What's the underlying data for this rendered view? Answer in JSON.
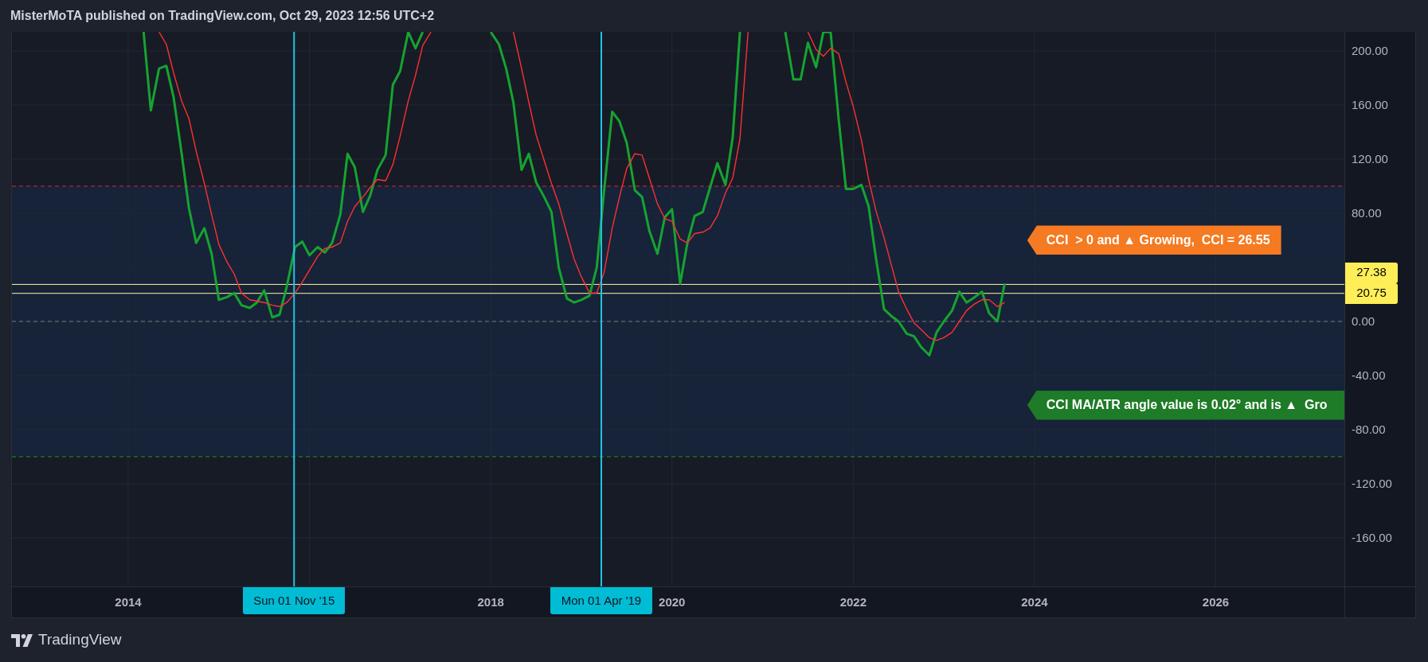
{
  "header": {
    "text": "MisterMoTA published on TradingView.com, Oct 29, 2023 12:56 UTC+2"
  },
  "chart": {
    "chart_data": {
      "type": "line",
      "xlim": [
        2012.717,
        2028.21
      ],
      "ylim": [
        -195.9,
        214.1
      ],
      "grid": true,
      "xticks": [
        2014,
        2018,
        2020,
        2022,
        2024,
        2026
      ],
      "yticks": [
        {
          "value": 200,
          "label": "200.00"
        },
        {
          "value": 160,
          "label": "160.00"
        },
        {
          "value": 120,
          "label": "120.00"
        },
        {
          "value": 80,
          "label": "80.00"
        },
        {
          "value": 0,
          "label": "0.00"
        },
        {
          "value": -40,
          "label": "-40.00"
        },
        {
          "value": -80,
          "label": "-80.00"
        },
        {
          "value": -120,
          "label": "-120.00"
        },
        {
          "value": -160,
          "label": "-160.00"
        }
      ],
      "x": [
        2014.17,
        2014.25,
        2014.34,
        2014.42,
        2014.5,
        2014.59,
        2014.67,
        2014.75,
        2014.84,
        2014.92,
        2015.0,
        2015.09,
        2015.17,
        2015.25,
        2015.34,
        2015.42,
        2015.5,
        2015.59,
        2015.67,
        2015.75,
        2015.84,
        2015.92,
        2016.0,
        2016.09,
        2016.17,
        2016.25,
        2016.34,
        2016.42,
        2016.5,
        2016.59,
        2016.67,
        2016.75,
        2016.84,
        2016.92,
        2017.0,
        2017.09,
        2017.17,
        2017.25,
        2017.34,
        2017.42,
        2017.5,
        2017.59,
        2017.67,
        2017.75,
        2017.84,
        2017.92,
        2018.0,
        2018.09,
        2018.17,
        2018.25,
        2018.34,
        2018.42,
        2018.5,
        2018.59,
        2018.67,
        2018.75,
        2018.84,
        2018.92,
        2019.0,
        2019.09,
        2019.17,
        2019.25,
        2019.34,
        2019.42,
        2019.5,
        2019.59,
        2019.67,
        2019.75,
        2019.84,
        2019.92,
        2020.0,
        2020.09,
        2020.17,
        2020.25,
        2020.34,
        2020.42,
        2020.5,
        2020.59,
        2020.67,
        2020.75,
        2020.84,
        2020.92,
        2021.0,
        2021.09,
        2021.17,
        2021.25,
        2021.34,
        2021.42,
        2021.5,
        2021.59,
        2021.67,
        2021.75,
        2021.84,
        2021.92,
        2022.0,
        2022.09,
        2022.17,
        2022.25,
        2022.34,
        2022.42,
        2022.5,
        2022.59,
        2022.67,
        2022.75,
        2022.84,
        2022.92,
        2023.0,
        2023.09,
        2023.17,
        2023.25,
        2023.34,
        2023.42,
        2023.5,
        2023.59,
        2023.67
      ],
      "series": [
        {
          "color": "#16a330",
          "values": [
            214,
            156,
            187,
            189,
            166,
            124,
            84,
            58,
            69,
            50,
            16,
            18,
            21,
            12,
            10,
            14,
            23,
            3,
            5,
            26,
            55,
            59,
            49,
            55,
            51,
            58,
            79,
            124,
            114,
            81,
            93,
            112,
            123,
            175,
            185,
            214,
            202,
            214,
            null,
            null,
            null,
            null,
            null,
            null,
            null,
            null,
            214,
            205,
            187,
            162,
            112,
            124,
            103,
            92,
            81,
            40,
            17,
            14,
            16,
            19,
            40,
            96,
            155,
            148,
            132,
            97,
            92,
            67,
            50,
            77,
            83,
            28,
            58,
            78,
            81,
            99,
            117,
            101,
            136,
            214,
            null,
            null,
            null,
            null,
            null,
            214,
            179,
            179,
            206,
            188,
            214,
            214,
            149,
            98,
            98,
            101,
            85,
            47,
            9,
            4,
            0,
            -9,
            -11,
            -19,
            -25,
            -8,
            0,
            8,
            22,
            14,
            18,
            22,
            6,
            0,
            28
          ]
        },
        {
          "color": "#ff3030",
          "values": [
            null,
            null,
            214,
            205,
            184,
            163,
            150,
            126,
            102,
            79,
            57,
            44,
            35,
            21,
            16,
            15,
            14,
            12,
            11,
            14,
            21,
            29,
            38,
            48,
            54,
            55,
            58,
            74,
            85,
            92,
            99,
            105,
            104,
            116,
            137,
            163,
            182,
            204,
            214,
            null,
            null,
            null,
            null,
            null,
            null,
            null,
            null,
            null,
            null,
            214,
            187,
            162,
            138,
            119,
            102,
            87,
            65,
            46,
            33,
            21,
            21,
            36,
            69,
            92,
            113,
            124,
            123,
            106,
            87,
            76,
            74,
            61,
            58,
            65,
            66,
            69,
            78,
            95,
            106,
            135,
            214,
            null,
            null,
            null,
            null,
            null,
            null,
            null,
            214,
            201,
            196,
            202,
            198,
            177,
            159,
            134,
            105,
            82,
            62,
            42,
            22,
            9,
            -1,
            -6,
            -12,
            -14,
            -12,
            -8,
            0,
            8,
            13,
            16,
            16,
            11,
            14
          ]
        }
      ],
      "bands": [
        {
          "axis": "y",
          "from": -100,
          "to": 100,
          "color": "#172339"
        }
      ],
      "ref_lines": [
        {
          "axis": "y",
          "value": 100,
          "color": "#e0222f"
        },
        {
          "axis": "y",
          "value": 0,
          "color": "#787b86"
        },
        {
          "axis": "y",
          "value": -100,
          "color": "#1c9a23"
        },
        {
          "axis": "y",
          "value": 27.38,
          "label": "27.38",
          "color": "#fff59d"
        },
        {
          "axis": "y",
          "value": 20.75,
          "label": "20.75",
          "color": "#fff59d"
        },
        {
          "axis": "x",
          "value": 2015.83,
          "label": "Sun 01 Nov '15",
          "color": "#22c3dd"
        },
        {
          "axis": "x",
          "value": 2019.22,
          "label": "Mon 01 Apr '19",
          "color": "#22c3dd"
        }
      ]
    },
    "callouts": [
      {
        "text": "CCI  > 0 and ▲ Growing,  CCI = 26.55",
        "color": "#f57a22",
        "cut_off": false
      },
      {
        "text": "CCI MA/ATR angle value is 0.02° and is ▲  Gro",
        "color": "#1e7b27",
        "cut_off": true
      }
    ]
  },
  "footer": {
    "brand": "TradingView"
  }
}
